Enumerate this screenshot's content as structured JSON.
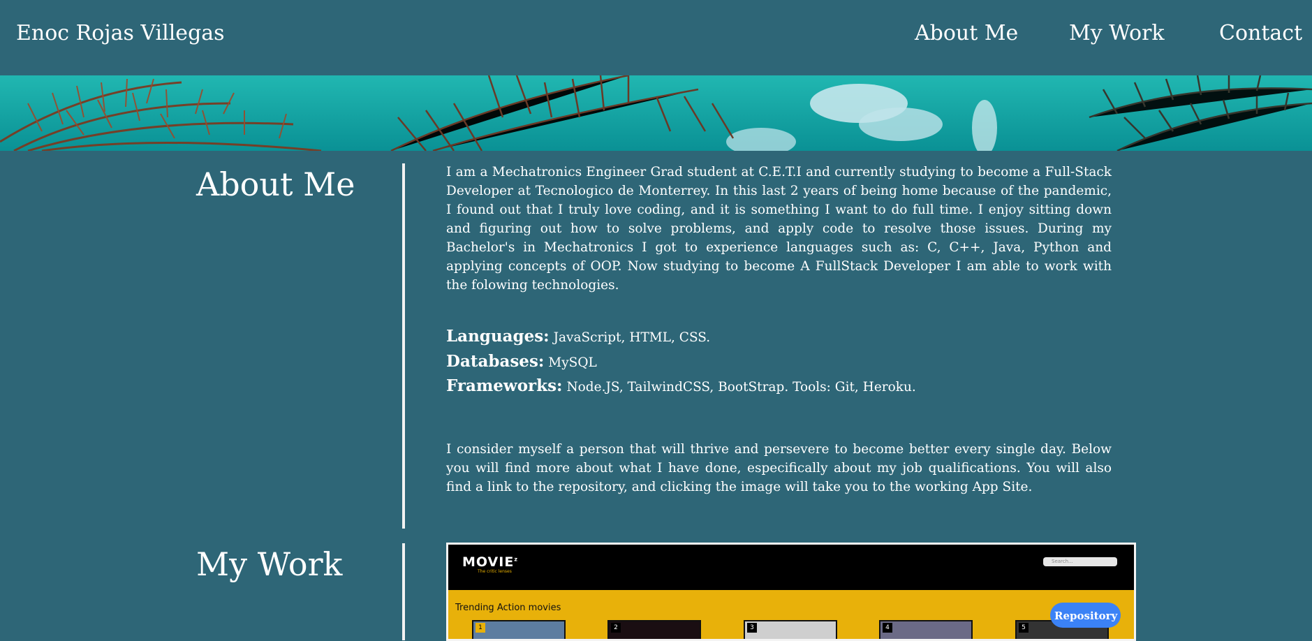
{
  "header": {
    "site_name": "Enoc Rojas Villegas",
    "nav": [
      "About Me",
      "My Work",
      "Contact"
    ]
  },
  "colors": {
    "background": "#2e6677",
    "text": "#ffffff",
    "divider": "#f2f2f2",
    "repository_button": "#3b82f6"
  },
  "about": {
    "title": "About Me",
    "intro": "I am a Mechatronics Engineer Grad student at C.E.T.I and currently studying to become a Full-Stack Developer at Tecnologico de Monterrey. In this last 2 years of being home because of the pandemic, I found out that I truly love coding, and it is something I want to do full time. I enjoy sitting down and figuring out how to solve problems, and apply code to resolve those issues. During my Bachelor's in Mechatronics I got to experience languages such as: C, C++, Java, Python and applying concepts of OOP. Now studying to become A FullStack Developer I am able to work with the folowing technologies.",
    "skills": [
      {
        "label": "Languages:",
        "value": "JavaScript, HTML, CSS."
      },
      {
        "label": "Databases:",
        "value": "MySQL"
      },
      {
        "label": "Frameworks:",
        "value": "Node.JS, TailwindCSS, BootStrap. Tools: Git, Heroku."
      }
    ],
    "closing": "I consider myself a person that will thrive and persevere to become better every single day. Below you will find more about what I have done, especifically about my job qualifications. You will also find a link to the repository, and clicking the image will take you to the working App Site."
  },
  "work": {
    "title": "My Work",
    "project": {
      "logo": "MOVIE",
      "logo_sup": "z",
      "tagline": "The critic lenses",
      "search_placeholder": "Search...",
      "heading": "Trending Action movies",
      "thumbs": [
        "1",
        "2",
        "3",
        "4",
        "5"
      ]
    },
    "repository_label": "Repository"
  },
  "icons": {
    "banner": "palm-trees-banner-image"
  }
}
